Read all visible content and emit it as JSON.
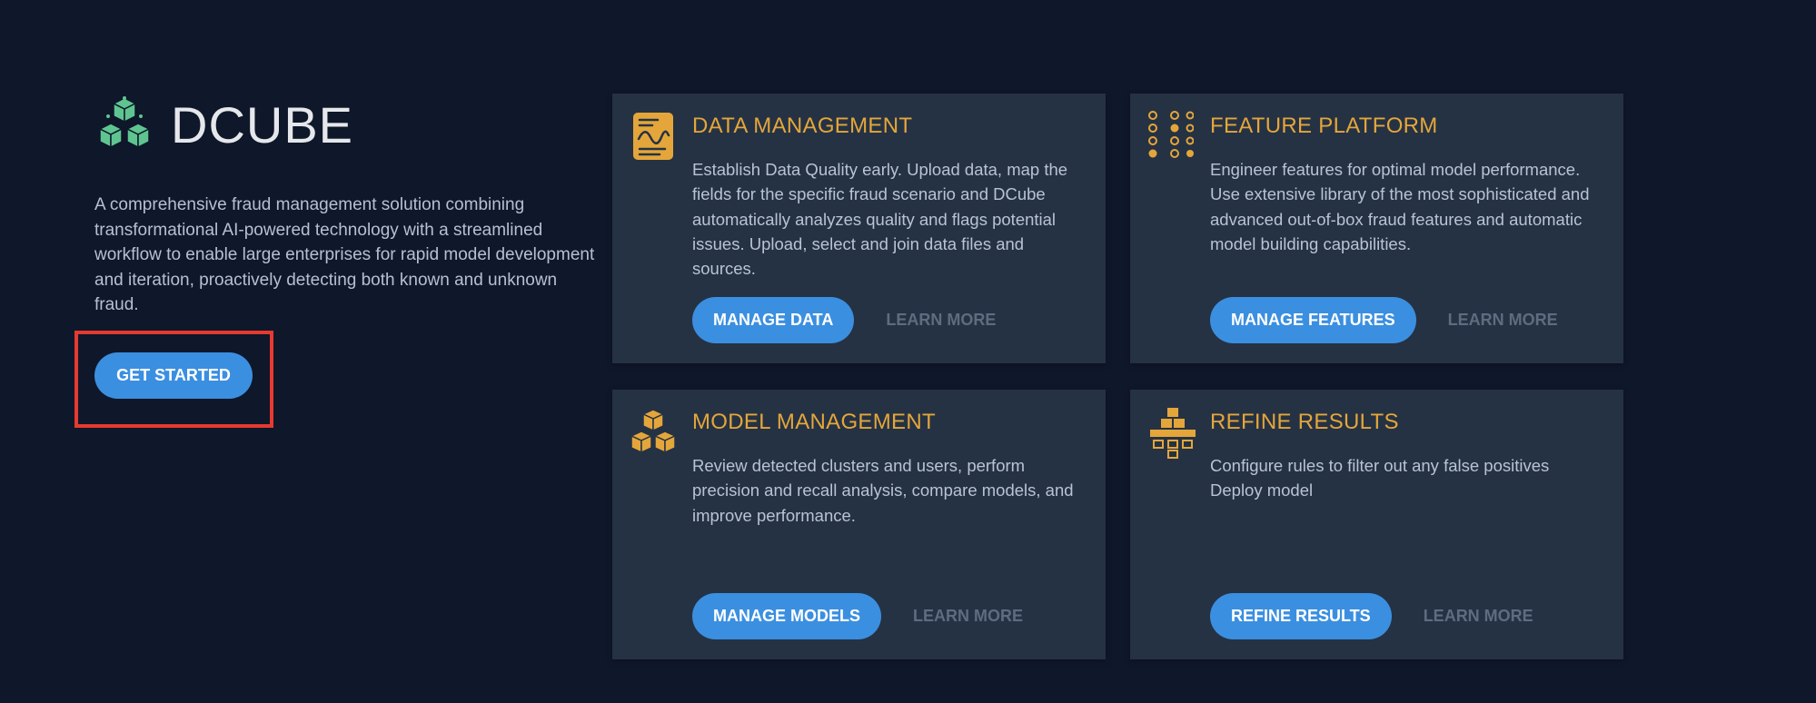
{
  "brand": {
    "name": "DCUBE",
    "icon": "cubes-logo-icon",
    "color": "#5fc590"
  },
  "intro": {
    "description": "A comprehensive fraud management solution combining transformational AI-powered technology with a streamlined workflow to enable large enterprises for rapid model development and iteration, proactively detecting both known and unknown fraud.",
    "cta_label": "GET STARTED"
  },
  "colors": {
    "background": "#0f172a",
    "card": "#253244",
    "accent": "#e4a63a",
    "primary_button": "#3b8fe0",
    "highlight": "#e53a2f"
  },
  "cards": [
    {
      "icon": "data-document-icon",
      "title": "DATA MANAGEMENT",
      "description": "Establish Data Quality early. Upload data, map the fields for the specific fraud scenario and DCube automatically analyzes quality and flags potential issues. Upload, select and join data files and sources.",
      "button": "MANAGE DATA",
      "learn_more": "LEARN MORE"
    },
    {
      "icon": "dot-grid-icon",
      "title": "FEATURE PLATFORM",
      "description": "Engineer features for optimal model performance. Use extensive library of the most sophisticated and advanced out-of-box fraud features and automatic model building capabilities.",
      "button": "MANAGE FEATURES",
      "learn_more": "LEARN MORE"
    },
    {
      "icon": "cubes-icon",
      "title": "MODEL MANAGEMENT",
      "description": "Review detected clusters and users, perform precision and recall analysis, compare models, and improve performance.",
      "button": "MANAGE MODELS",
      "learn_more": "LEARN MORE"
    },
    {
      "icon": "hierarchy-blocks-icon",
      "title": "REFINE RESULTS",
      "description": "Configure rules to filter out any false positives Deploy model",
      "button": "REFINE RESULTS",
      "learn_more": "LEARN MORE"
    }
  ]
}
